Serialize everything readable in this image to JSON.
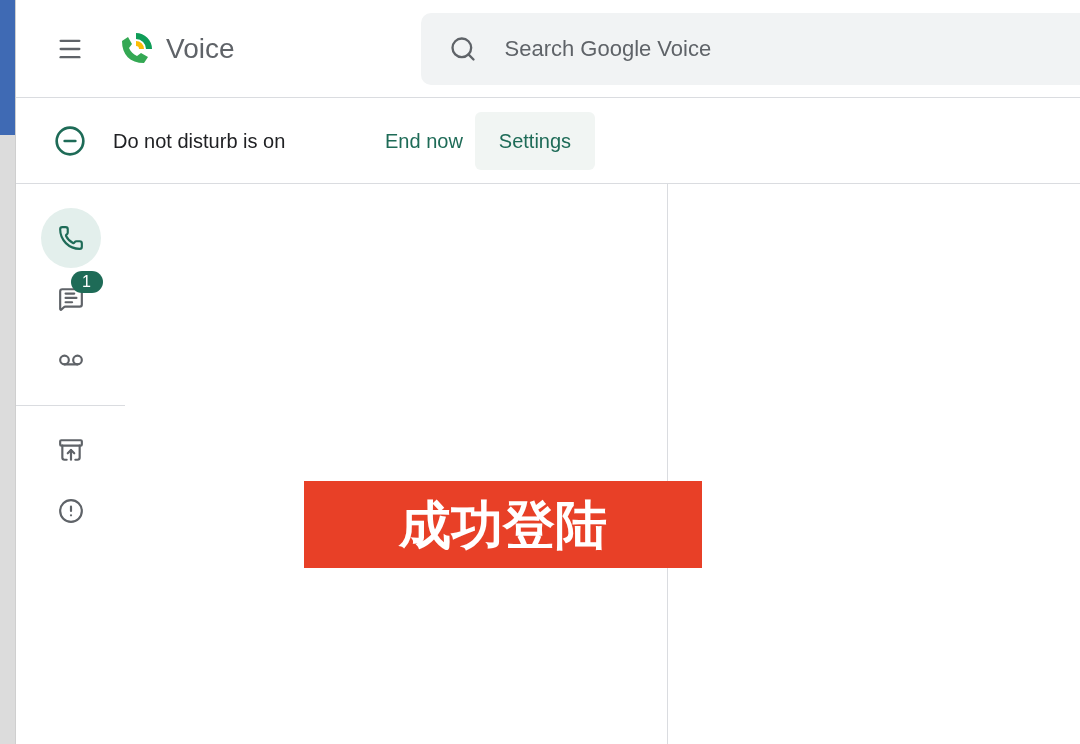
{
  "header": {
    "app_name": "Voice",
    "search": {
      "placeholder": "Search Google Voice"
    }
  },
  "dnd_bar": {
    "message": "Do not disturb is on",
    "actions": [
      {
        "label": "End now",
        "kind": "link"
      },
      {
        "label": "Settings",
        "kind": "button"
      }
    ]
  },
  "nav": {
    "items": [
      {
        "kind": "calls",
        "selected": true
      },
      {
        "kind": "messages",
        "selected": false,
        "badge": "1"
      },
      {
        "kind": "voicemail",
        "selected": false
      },
      {
        "kind": "divider"
      },
      {
        "kind": "archive",
        "selected": false
      },
      {
        "kind": "spam",
        "selected": false
      }
    ]
  },
  "caption": "成功登陆"
}
